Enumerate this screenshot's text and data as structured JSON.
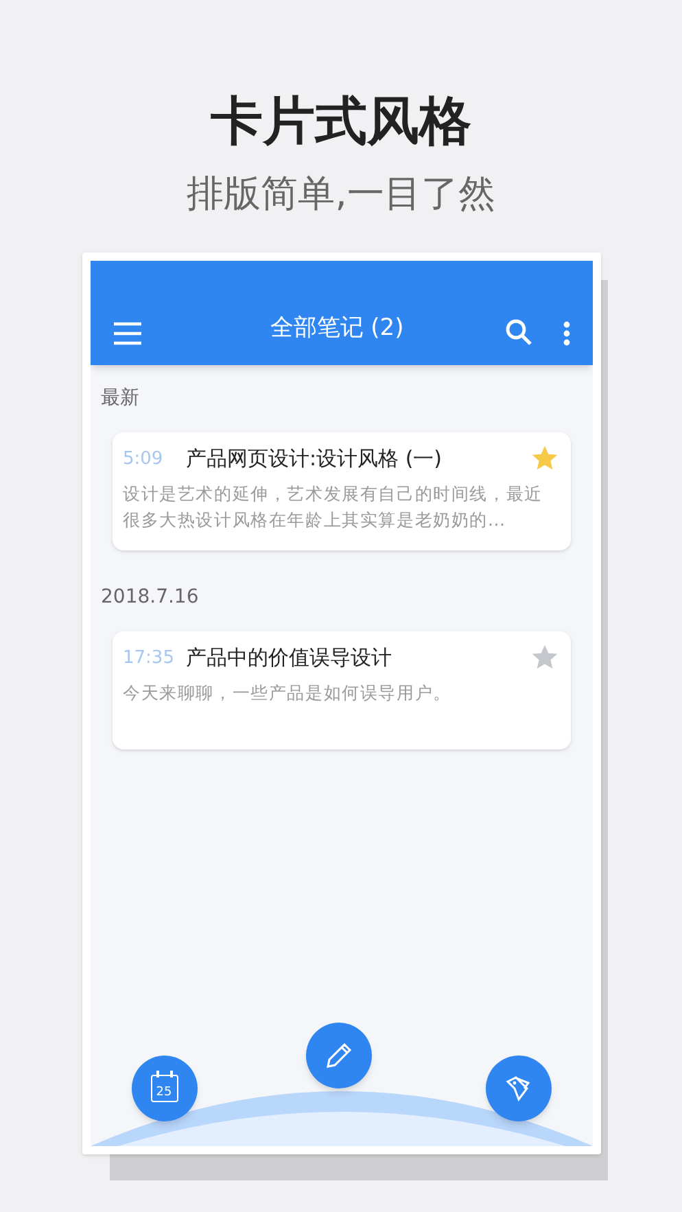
{
  "headline": "卡片式风格",
  "subtitle": "排版简单,一目了然",
  "toolbar": {
    "title": "全部笔记 (2)"
  },
  "sections": [
    {
      "label": "最新",
      "notes": [
        {
          "time": "5:09",
          "title": "产品网页设计:设计风格 (一)",
          "starred": true,
          "preview": "设计是艺术的延伸，艺术发展有自己的时间线，最近很多大热设计风格在年龄上其实算是老奶奶的..."
        }
      ]
    },
    {
      "label": "2018.7.16",
      "notes": [
        {
          "time": "17:35",
          "title": "产品中的价值误导设计",
          "starred": false,
          "preview": "今天来聊聊，一些产品是如何误导用户。"
        }
      ]
    }
  ],
  "calendar_day": "25"
}
